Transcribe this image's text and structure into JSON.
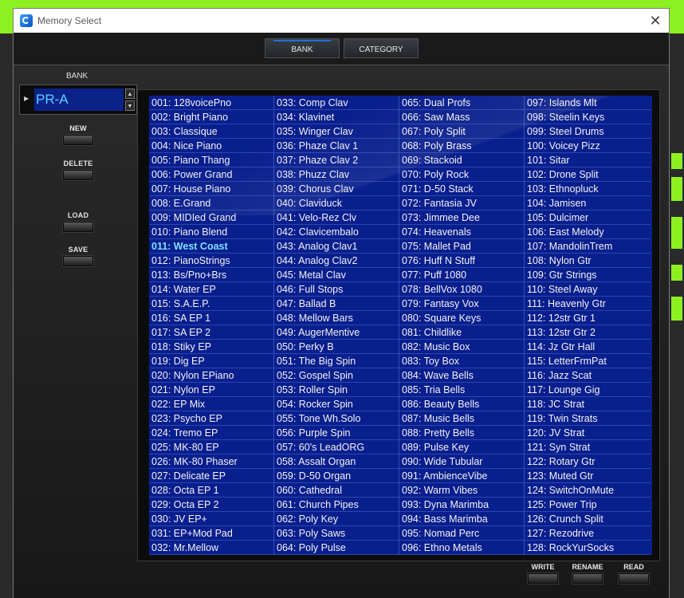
{
  "window": {
    "title": "Memory Select",
    "close_glyph": "✕"
  },
  "tabs": [
    {
      "label": "BANK",
      "active": true
    },
    {
      "label": "CATEGORY",
      "active": false
    }
  ],
  "bank": {
    "label": "BANK",
    "value": "PR-A",
    "arrow": "▶",
    "up": "▲",
    "down": "▼"
  },
  "side_buttons": {
    "new": "NEW",
    "delete": "DELETE",
    "load": "LOAD",
    "save": "SAVE"
  },
  "bottom_buttons": {
    "write": "WRITE",
    "rename": "RENAME",
    "read": "READ"
  },
  "selected_patch": "011: West Coast",
  "patches": [
    [
      "001: 128voicePno",
      "002: Bright Piano",
      "003: Classique",
      "004: Nice Piano",
      "005: Piano Thang",
      "006: Power Grand",
      "007: House Piano",
      "008: E.Grand",
      "009: MIDIed Grand",
      "010: Piano Blend",
      "011: West Coast",
      "012: PianoStrings",
      "013: Bs/Pno+Brs",
      "014: Water EP",
      "015: S.A.E.P.",
      "016: SA EP 1",
      "017: SA EP 2",
      "018: Stiky EP",
      "019: Dig EP",
      "020: Nylon EPiano",
      "021: Nylon EP",
      "022: EP Mix",
      "023: Psycho EP",
      "024: Tremo EP",
      "025: MK-80 EP",
      "026: MK-80 Phaser",
      "027: Delicate EP",
      "028: Octa EP 1",
      "029: Octa EP 2",
      "030: JV EP+",
      "031: EP+Mod Pad",
      "032: Mr.Mellow"
    ],
    [
      "033: Comp Clav",
      "034: Klavinet",
      "035: Winger Clav",
      "036: Phaze Clav 1",
      "037: Phaze Clav 2",
      "038: Phuzz Clav",
      "039: Chorus Clav",
      "040: Claviduck",
      "041: Velo-Rez Clv",
      "042: Clavicembalo",
      "043: Analog Clav1",
      "044: Analog Clav2",
      "045: Metal Clav",
      "046: Full Stops",
      "047: Ballad B",
      "048: Mellow Bars",
      "049: AugerMentive",
      "050: Perky B",
      "051: The Big Spin",
      "052: Gospel Spin",
      "053: Roller Spin",
      "054: Rocker Spin",
      "055: Tone Wh.Solo",
      "056: Purple Spin",
      "057: 60's LeadORG",
      "058: Assalt Organ",
      "059: D-50 Organ",
      "060: Cathedral",
      "061: Church Pipes",
      "062: Poly Key",
      "063: Poly Saws",
      "064: Poly Pulse"
    ],
    [
      "065: Dual Profs",
      "066: Saw Mass",
      "067: Poly Split",
      "068: Poly Brass",
      "069: Stackoid",
      "070: Poly Rock",
      "071: D-50 Stack",
      "072: Fantasia JV",
      "073: Jimmee Dee",
      "074: Heavenals",
      "075: Mallet Pad",
      "076: Huff N Stuff",
      "077: Puff 1080",
      "078: BellVox 1080",
      "079: Fantasy Vox",
      "080: Square Keys",
      "081: Childlike",
      "082: Music Box",
      "083: Toy Box",
      "084: Wave Bells",
      "085: Tria Bells",
      "086: Beauty Bells",
      "087: Music Bells",
      "088: Pretty Bells",
      "089: Pulse Key",
      "090: Wide Tubular",
      "091: AmbienceVibe",
      "092: Warm Vibes",
      "093: Dyna Marimba",
      "094: Bass Marimba",
      "095: Nomad Perc",
      "096: Ethno Metals"
    ],
    [
      "097: Islands Mlt",
      "098: Steelin Keys",
      "099: Steel Drums",
      "100: Voicey Pizz",
      "101: Sitar",
      "102: Drone Split",
      "103: Ethnopluck",
      "104: Jamisen",
      "105: Dulcimer",
      "106: East Melody",
      "107: MandolinTrem",
      "108: Nylon Gtr",
      "109: Gtr Strings",
      "110: Steel Away",
      "111: Heavenly Gtr",
      "112: 12str Gtr 1",
      "113: 12str Gtr 2",
      "114: Jz Gtr Hall",
      "115: LetterFrmPat",
      "116: Jazz Scat",
      "117: Lounge Gig",
      "118: JC Strat",
      "119: Twin Strats",
      "120: JV Strat",
      "121: Syn Strat",
      "122: Rotary Gtr",
      "123: Muted Gtr",
      "124: SwitchOnMute",
      "125: Power Trip",
      "126: Crunch Split",
      "127: Rezodrive",
      "128: RockYurSocks"
    ]
  ],
  "colors": {
    "list_bg": "#0a1f8e",
    "selected_text": "#7fe0ff",
    "host_green": "#8df021"
  }
}
